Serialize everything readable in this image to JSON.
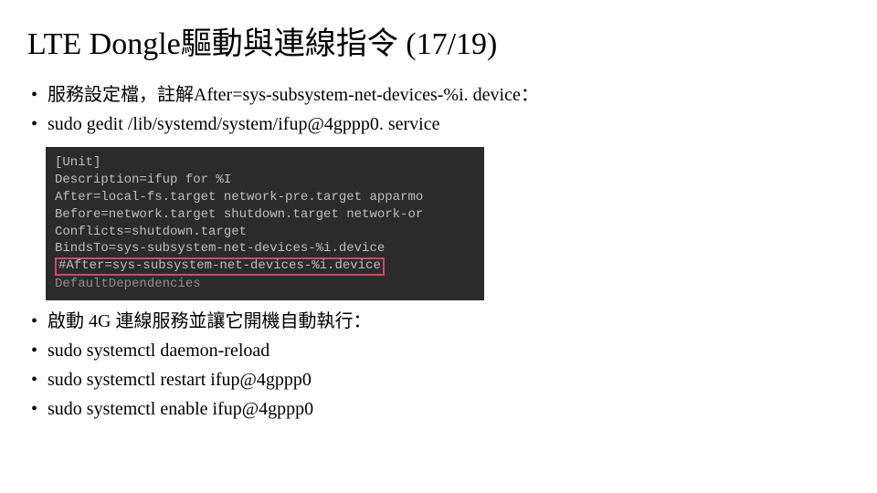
{
  "title": "LTE Dongle驅動與連線指令 (17/19)",
  "bullets_top": [
    "服務設定檔，註解After=sys-subsystem-net-devices-%i. device：",
    "sudo gedit /lib/systemd/system/ifup@4gppp0. service"
  ],
  "terminal": {
    "lines": [
      "[Unit]",
      "Description=ifup for %I",
      "After=local-fs.target network-pre.target apparmo",
      "Before=network.target shutdown.target network-or",
      "Conflicts=shutdown.target",
      "BindsTo=sys-subsystem-net-devices-%i.device"
    ],
    "highlighted": "#After=sys-subsystem-net-devices-%i.device",
    "trailing": "DefaultDependencies"
  },
  "bullets_bottom": [
    "啟動 4G 連線服務並讓它開機自動執行：",
    "sudo systemctl daemon-reload",
    "sudo systemctl restart ifup@4gppp0",
    "sudo systemctl enable ifup@4gppp0"
  ]
}
